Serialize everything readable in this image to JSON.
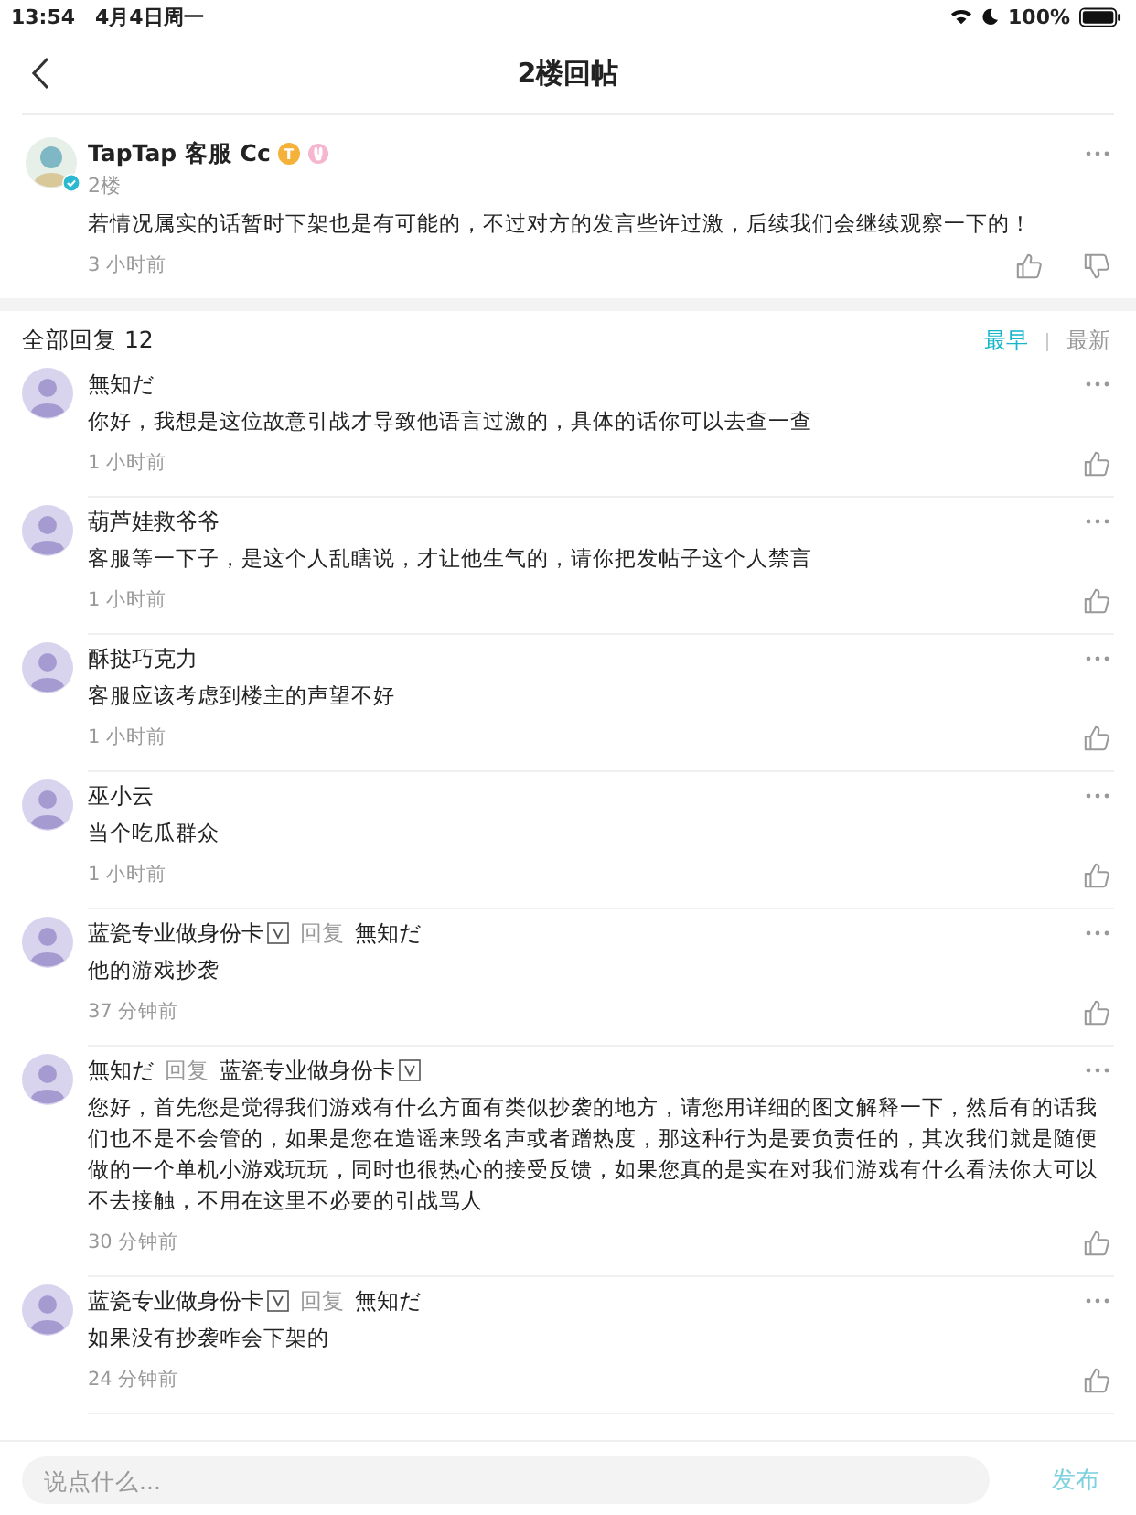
{
  "status_bar": {
    "time": "13:54",
    "date": "4月4日周一",
    "battery": "100%"
  },
  "nav": {
    "title": "2楼回帖"
  },
  "post": {
    "author": "TapTap 客服 Cc",
    "badge": "T",
    "verified": true,
    "floor": "2楼",
    "text": "若情况属实的话暂时下架也是有可能的，不过对方的发言些许过激，后续我们会继续观察一下的！",
    "time": "3 小时前"
  },
  "replies_header": {
    "label": "全部回复 12",
    "sorts": [
      {
        "label": "最早",
        "selected": true
      },
      {
        "label": "最新",
        "selected": false
      }
    ]
  },
  "comments": [
    {
      "author": "無知だ",
      "text": "你好，我想是这位故意引战才导致他语言过激的，具体的话你可以去查一查",
      "time": "1 小时前"
    },
    {
      "author": "葫芦娃救爷爷",
      "text": "客服等一下子，是这个人乱瞎说，才让他生气的，请你把发帖子这个人禁言",
      "time": "1 小时前"
    },
    {
      "author": "酥挞巧克力",
      "text": "客服应该考虑到楼主的声望不好",
      "time": "1 小时前"
    },
    {
      "author": "巫小云",
      "text": "当个吃瓜群众",
      "time": "1 小时前"
    },
    {
      "author": "蓝瓷专业做身份卡",
      "author_vip": true,
      "reply_word": "回复",
      "reply_to": "無知だ",
      "reply_to_vip": false,
      "text": "他的游戏抄袭",
      "time": "37 分钟前"
    },
    {
      "author": "無知だ",
      "author_vip": false,
      "reply_word": "回复",
      "reply_to": "蓝瓷专业做身份卡",
      "reply_to_vip": true,
      "text": "您好，首先您是觉得我们游戏有什么方面有类似抄袭的地方，请您用详细的图文解释一下，然后有的话我们也不是不会管的，如果是您在造谣来毁名声或者蹭热度，那这种行为是要负责任的，其次我们就是随便做的一个单机小游戏玩玩，同时也很热心的接受反馈，如果您真的是实在对我们游戏有什么看法你大可以不去接触，不用在这里不必要的引战骂人",
      "time": "30 分钟前"
    },
    {
      "author": "蓝瓷专业做身份卡",
      "author_vip": true,
      "reply_word": "回复",
      "reply_to": "無知だ",
      "reply_to_vip": false,
      "text": "如果没有抄袭咋会下架的",
      "time": "24 分钟前"
    }
  ],
  "composer": {
    "placeholder": "说点什么...",
    "send": "发布"
  }
}
